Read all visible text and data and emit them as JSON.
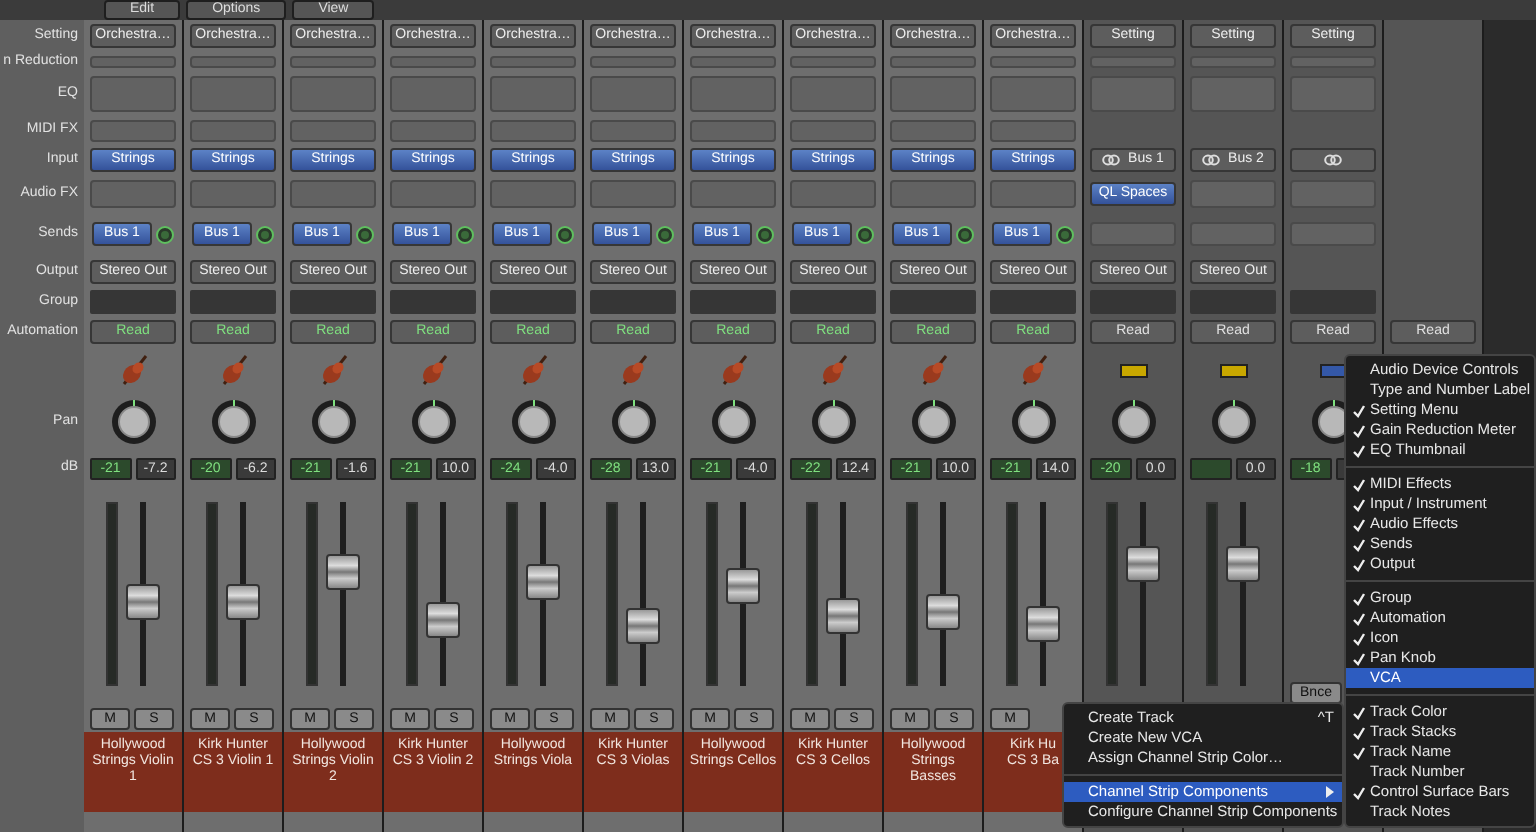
{
  "toolbar": {
    "menus": [
      "Edit",
      "Options",
      "View"
    ]
  },
  "row_labels": {
    "setting": "Setting",
    "gain": "n Reduction",
    "eq": "EQ",
    "midi": "MIDI FX",
    "input": "Input",
    "audiofx": "Audio FX",
    "sends": "Sends",
    "output": "Output",
    "group": "Group",
    "automation": "Automation",
    "pan": "Pan",
    "db": "dB"
  },
  "channels": [
    {
      "kind": "instrument",
      "setting": "Orchestra…",
      "input": "Strings",
      "send": "Bus 1",
      "output": "Stereo Out",
      "automation": "Read",
      "peak": "-21",
      "gain": "-7.2",
      "level": 0.45,
      "mute": "M",
      "solo": "S",
      "name": "Hollywood Strings Violin 1"
    },
    {
      "kind": "instrument",
      "setting": "Orchestra…",
      "input": "Strings",
      "send": "Bus 1",
      "output": "Stereo Out",
      "automation": "Read",
      "peak": "-20",
      "gain": "-6.2",
      "level": 0.45,
      "mute": "M",
      "solo": "S",
      "name": "Kirk Hunter CS 3 Violin 1"
    },
    {
      "kind": "instrument",
      "setting": "Orchestra…",
      "input": "Strings",
      "send": "Bus 1",
      "output": "Stereo Out",
      "automation": "Read",
      "peak": "-21",
      "gain": "-1.6",
      "level": 0.65,
      "mute": "M",
      "solo": "S",
      "name": "Hollywood Strings Violin 2"
    },
    {
      "kind": "instrument",
      "setting": "Orchestra…",
      "input": "Strings",
      "send": "Bus 1",
      "output": "Stereo Out",
      "automation": "Read",
      "peak": "-21",
      "gain": "10.0",
      "level": 0.33,
      "mute": "M",
      "solo": "S",
      "name": "Kirk Hunter CS 3 Violin 2"
    },
    {
      "kind": "instrument",
      "setting": "Orchestra…",
      "input": "Strings",
      "send": "Bus 1",
      "output": "Stereo Out",
      "automation": "Read",
      "peak": "-24",
      "gain": "-4.0",
      "level": 0.58,
      "mute": "M",
      "solo": "S",
      "name": "Hollywood Strings Viola"
    },
    {
      "kind": "instrument",
      "setting": "Orchestra…",
      "input": "Strings",
      "send": "Bus 1",
      "output": "Stereo Out",
      "automation": "Read",
      "peak": "-28",
      "gain": "13.0",
      "level": 0.28,
      "mute": "M",
      "solo": "S",
      "name": "Kirk Hunter CS 3 Violas"
    },
    {
      "kind": "instrument",
      "setting": "Orchestra…",
      "input": "Strings",
      "send": "Bus 1",
      "output": "Stereo Out",
      "automation": "Read",
      "peak": "-21",
      "gain": "-4.0",
      "level": 0.55,
      "mute": "M",
      "solo": "S",
      "name": "Hollywood Strings Cellos"
    },
    {
      "kind": "instrument",
      "setting": "Orchestra…",
      "input": "Strings",
      "send": "Bus 1",
      "output": "Stereo Out",
      "automation": "Read",
      "peak": "-22",
      "gain": "12.4",
      "level": 0.35,
      "mute": "M",
      "solo": "S",
      "name": "Kirk Hunter CS 3 Cellos"
    },
    {
      "kind": "instrument",
      "setting": "Orchestra…",
      "input": "Strings",
      "send": "Bus 1",
      "output": "Stereo Out",
      "automation": "Read",
      "peak": "-21",
      "gain": "10.0",
      "level": 0.38,
      "mute": "M",
      "solo": "S",
      "name": "Hollywood Strings Basses"
    },
    {
      "kind": "instrument",
      "setting": "Orchestra…",
      "input": "Strings",
      "send": "Bus 1",
      "output": "Stereo Out",
      "automation": "Read",
      "peak": "-21",
      "gain": "14.0",
      "level": 0.3,
      "mute": "M",
      "name": "Kirk Hu\nCS 3 Ba"
    },
    {
      "kind": "aux",
      "setting": "Setting",
      "input": "Bus 1",
      "audio_fx": "QL Spaces",
      "output": "Stereo Out",
      "automation": "Read",
      "color": "#c9a800",
      "peak": "-20",
      "gain": "0.0",
      "level": 0.7
    },
    {
      "kind": "aux",
      "setting": "Setting",
      "input": "Bus 2",
      "output": "Stereo Out",
      "automation": "Read",
      "color": "#c9a800",
      "gain": "0.0",
      "level": 0.7
    },
    {
      "kind": "aux",
      "setting": "Setting",
      "automation": "Read",
      "color": "#3458a8",
      "peak": "-18",
      "bounce": "Bnce"
    },
    {
      "kind": "output",
      "automation": "Read"
    }
  ],
  "context_menu": {
    "items": [
      {
        "kind": "item",
        "label": "Create Track",
        "shortcut": "^T",
        "selected": false
      },
      {
        "kind": "item",
        "label": "Create New VCA",
        "selected": false
      },
      {
        "kind": "item",
        "label": "Assign Channel Strip Color…",
        "selected": false
      },
      {
        "kind": "separator"
      },
      {
        "kind": "submenu",
        "label": "Channel Strip Components",
        "selected": true
      },
      {
        "kind": "item",
        "label": "Configure Channel Strip Components",
        "selected": false
      }
    ]
  },
  "submenu": {
    "items": [
      {
        "kind": "item",
        "label": "Audio Device Controls",
        "checked": false,
        "selected": false
      },
      {
        "kind": "item",
        "label": "Type and Number Label",
        "checked": false,
        "selected": false
      },
      {
        "kind": "item",
        "label": "Setting Menu",
        "checked": true,
        "selected": false
      },
      {
        "kind": "item",
        "label": "Gain Reduction Meter",
        "checked": true,
        "selected": false
      },
      {
        "kind": "item",
        "label": "EQ Thumbnail",
        "checked": true,
        "selected": false
      },
      {
        "kind": "separator"
      },
      {
        "kind": "item",
        "label": "MIDI Effects",
        "checked": true,
        "selected": false
      },
      {
        "kind": "item",
        "label": "Input / Instrument",
        "checked": true,
        "selected": false
      },
      {
        "kind": "item",
        "label": "Audio Effects",
        "checked": true,
        "selected": false
      },
      {
        "kind": "item",
        "label": "Sends",
        "checked": true,
        "selected": false
      },
      {
        "kind": "item",
        "label": "Output",
        "checked": true,
        "selected": false
      },
      {
        "kind": "separator"
      },
      {
        "kind": "item",
        "label": "Group",
        "checked": true,
        "selected": false
      },
      {
        "kind": "item",
        "label": "Automation",
        "checked": true,
        "selected": false
      },
      {
        "kind": "item",
        "label": "Icon",
        "checked": true,
        "selected": false
      },
      {
        "kind": "item",
        "label": "Pan Knob",
        "checked": true,
        "selected": false
      },
      {
        "kind": "item",
        "label": "VCA",
        "checked": false,
        "selected": true
      },
      {
        "kind": "separator"
      },
      {
        "kind": "item",
        "label": "Track Color",
        "checked": true,
        "selected": false
      },
      {
        "kind": "item",
        "label": "Track Stacks",
        "checked": true,
        "selected": false
      },
      {
        "kind": "item",
        "label": "Track Name",
        "checked": true,
        "selected": false
      },
      {
        "kind": "item",
        "label": "Track Number",
        "checked": false,
        "selected": false
      },
      {
        "kind": "item",
        "label": "Control Surface Bars",
        "checked": true,
        "selected": false
      },
      {
        "kind": "item",
        "label": "Track Notes",
        "checked": false,
        "selected": false
      }
    ]
  }
}
